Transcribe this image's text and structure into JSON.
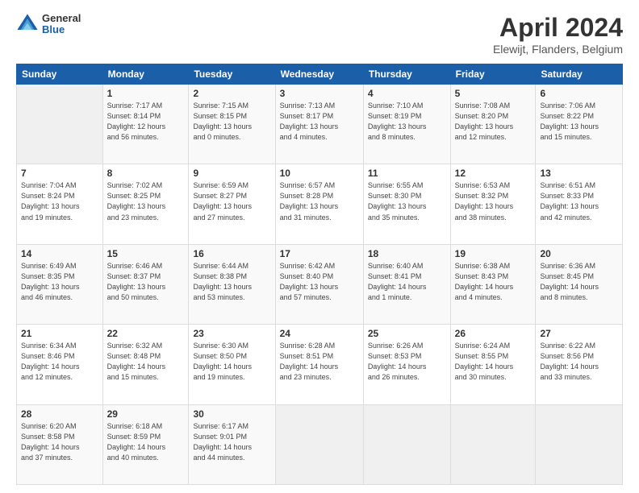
{
  "header": {
    "logo_general": "General",
    "logo_blue": "Blue",
    "month_year": "April 2024",
    "location": "Elewijt, Flanders, Belgium"
  },
  "weekdays": [
    "Sunday",
    "Monday",
    "Tuesday",
    "Wednesday",
    "Thursday",
    "Friday",
    "Saturday"
  ],
  "weeks": [
    [
      {
        "num": "",
        "info": ""
      },
      {
        "num": "1",
        "info": "Sunrise: 7:17 AM\nSunset: 8:14 PM\nDaylight: 12 hours\nand 56 minutes."
      },
      {
        "num": "2",
        "info": "Sunrise: 7:15 AM\nSunset: 8:15 PM\nDaylight: 13 hours\nand 0 minutes."
      },
      {
        "num": "3",
        "info": "Sunrise: 7:13 AM\nSunset: 8:17 PM\nDaylight: 13 hours\nand 4 minutes."
      },
      {
        "num": "4",
        "info": "Sunrise: 7:10 AM\nSunset: 8:19 PM\nDaylight: 13 hours\nand 8 minutes."
      },
      {
        "num": "5",
        "info": "Sunrise: 7:08 AM\nSunset: 8:20 PM\nDaylight: 13 hours\nand 12 minutes."
      },
      {
        "num": "6",
        "info": "Sunrise: 7:06 AM\nSunset: 8:22 PM\nDaylight: 13 hours\nand 15 minutes."
      }
    ],
    [
      {
        "num": "7",
        "info": "Sunrise: 7:04 AM\nSunset: 8:24 PM\nDaylight: 13 hours\nand 19 minutes."
      },
      {
        "num": "8",
        "info": "Sunrise: 7:02 AM\nSunset: 8:25 PM\nDaylight: 13 hours\nand 23 minutes."
      },
      {
        "num": "9",
        "info": "Sunrise: 6:59 AM\nSunset: 8:27 PM\nDaylight: 13 hours\nand 27 minutes."
      },
      {
        "num": "10",
        "info": "Sunrise: 6:57 AM\nSunset: 8:28 PM\nDaylight: 13 hours\nand 31 minutes."
      },
      {
        "num": "11",
        "info": "Sunrise: 6:55 AM\nSunset: 8:30 PM\nDaylight: 13 hours\nand 35 minutes."
      },
      {
        "num": "12",
        "info": "Sunrise: 6:53 AM\nSunset: 8:32 PM\nDaylight: 13 hours\nand 38 minutes."
      },
      {
        "num": "13",
        "info": "Sunrise: 6:51 AM\nSunset: 8:33 PM\nDaylight: 13 hours\nand 42 minutes."
      }
    ],
    [
      {
        "num": "14",
        "info": "Sunrise: 6:49 AM\nSunset: 8:35 PM\nDaylight: 13 hours\nand 46 minutes."
      },
      {
        "num": "15",
        "info": "Sunrise: 6:46 AM\nSunset: 8:37 PM\nDaylight: 13 hours\nand 50 minutes."
      },
      {
        "num": "16",
        "info": "Sunrise: 6:44 AM\nSunset: 8:38 PM\nDaylight: 13 hours\nand 53 minutes."
      },
      {
        "num": "17",
        "info": "Sunrise: 6:42 AM\nSunset: 8:40 PM\nDaylight: 13 hours\nand 57 minutes."
      },
      {
        "num": "18",
        "info": "Sunrise: 6:40 AM\nSunset: 8:41 PM\nDaylight: 14 hours\nand 1 minute."
      },
      {
        "num": "19",
        "info": "Sunrise: 6:38 AM\nSunset: 8:43 PM\nDaylight: 14 hours\nand 4 minutes."
      },
      {
        "num": "20",
        "info": "Sunrise: 6:36 AM\nSunset: 8:45 PM\nDaylight: 14 hours\nand 8 minutes."
      }
    ],
    [
      {
        "num": "21",
        "info": "Sunrise: 6:34 AM\nSunset: 8:46 PM\nDaylight: 14 hours\nand 12 minutes."
      },
      {
        "num": "22",
        "info": "Sunrise: 6:32 AM\nSunset: 8:48 PM\nDaylight: 14 hours\nand 15 minutes."
      },
      {
        "num": "23",
        "info": "Sunrise: 6:30 AM\nSunset: 8:50 PM\nDaylight: 14 hours\nand 19 minutes."
      },
      {
        "num": "24",
        "info": "Sunrise: 6:28 AM\nSunset: 8:51 PM\nDaylight: 14 hours\nand 23 minutes."
      },
      {
        "num": "25",
        "info": "Sunrise: 6:26 AM\nSunset: 8:53 PM\nDaylight: 14 hours\nand 26 minutes."
      },
      {
        "num": "26",
        "info": "Sunrise: 6:24 AM\nSunset: 8:55 PM\nDaylight: 14 hours\nand 30 minutes."
      },
      {
        "num": "27",
        "info": "Sunrise: 6:22 AM\nSunset: 8:56 PM\nDaylight: 14 hours\nand 33 minutes."
      }
    ],
    [
      {
        "num": "28",
        "info": "Sunrise: 6:20 AM\nSunset: 8:58 PM\nDaylight: 14 hours\nand 37 minutes."
      },
      {
        "num": "29",
        "info": "Sunrise: 6:18 AM\nSunset: 8:59 PM\nDaylight: 14 hours\nand 40 minutes."
      },
      {
        "num": "30",
        "info": "Sunrise: 6:17 AM\nSunset: 9:01 PM\nDaylight: 14 hours\nand 44 minutes."
      },
      {
        "num": "",
        "info": ""
      },
      {
        "num": "",
        "info": ""
      },
      {
        "num": "",
        "info": ""
      },
      {
        "num": "",
        "info": ""
      }
    ]
  ]
}
